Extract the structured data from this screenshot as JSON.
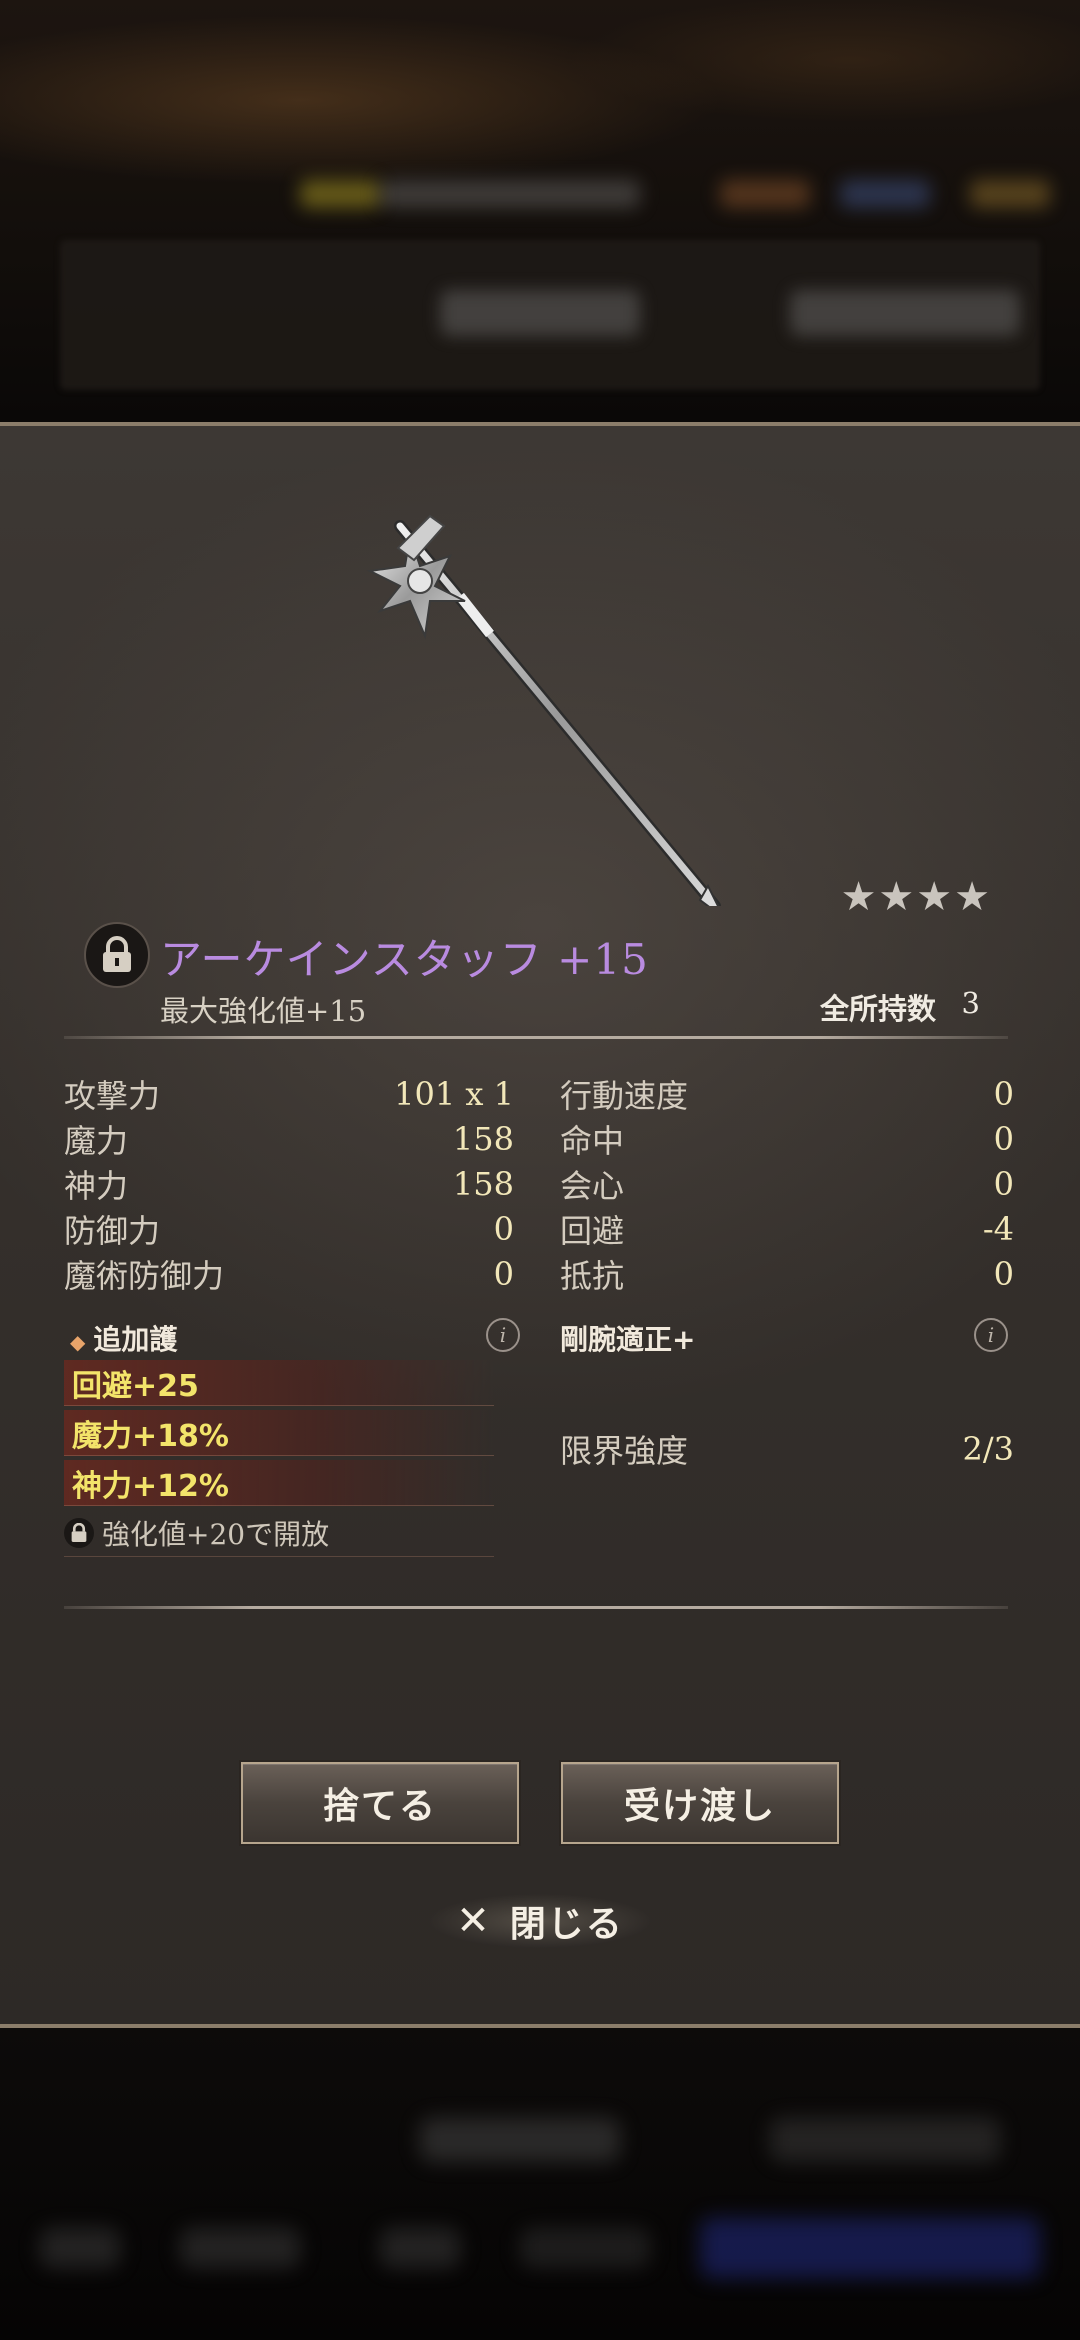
{
  "item": {
    "name": "アーケインスタッフ +15",
    "stars": "★★★★",
    "max_enhance": "最大強化値+15",
    "owned_label": "全所持数",
    "owned_count": "3"
  },
  "stats_left": [
    {
      "label": "攻撃力",
      "value": "101 x 1"
    },
    {
      "label": "魔力",
      "value": "158"
    },
    {
      "label": "神力",
      "value": "158"
    },
    {
      "label": "防御力",
      "value": "0"
    },
    {
      "label": "魔術防御力",
      "value": "0"
    }
  ],
  "stats_right": [
    {
      "label": "行動速度",
      "value": "0"
    },
    {
      "label": "命中",
      "value": "0"
    },
    {
      "label": "会心",
      "value": "0"
    },
    {
      "label": "回避",
      "value": "-4"
    },
    {
      "label": "抵抗",
      "value": "0"
    }
  ],
  "bonus": {
    "title": "追加護",
    "items": [
      "回避+25",
      "魔力+18%",
      "神力+12%"
    ],
    "locked_text": "強化値+20で開放"
  },
  "skill": {
    "name": "剛腕適正+",
    "limit_label": "限界強度",
    "limit_value": "2/3"
  },
  "buttons": {
    "discard": "捨てる",
    "transfer": "受け渡し",
    "close": "閉じる",
    "close_symbol": "✕"
  },
  "icons": {
    "lock": "lock-icon",
    "info": "info-icon",
    "weapon": "staff-icon"
  },
  "colors": {
    "item_name": "#b98be0",
    "bonus_text": "#f3e46a",
    "value_text": "#f2e7b9"
  }
}
